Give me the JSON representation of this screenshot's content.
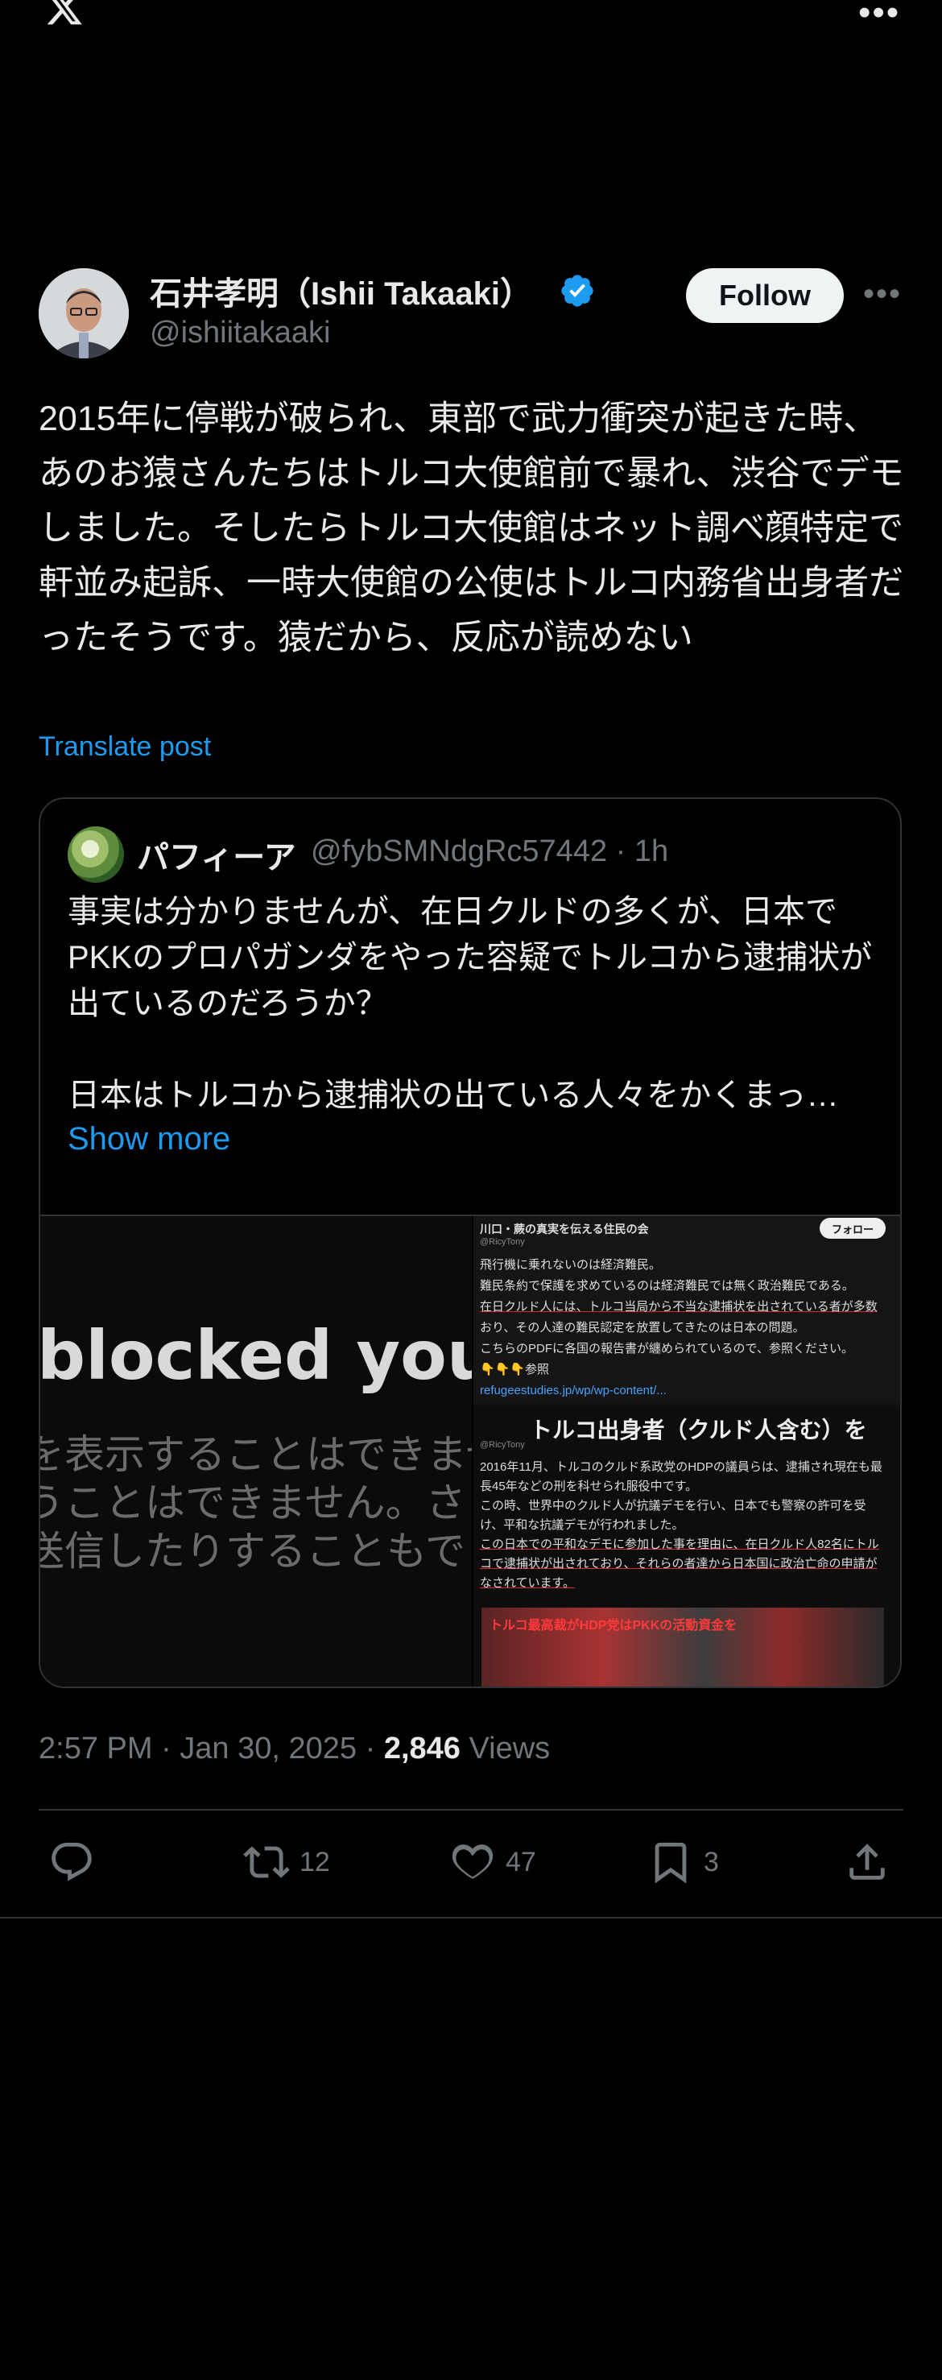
{
  "top_bar": {
    "logo_icon": "x-logo-icon",
    "more_icon": "more-dots-icon"
  },
  "author": {
    "name": "石井孝明（Ishii Takaaki）",
    "handle": "@ishiitakaaki",
    "verified_icon": "verified-badge-icon",
    "follow_label": "Follow"
  },
  "post": {
    "text": "2015年に停戦が破られ、東部で武力衝突が起きた時、あのお猿さんたちはトルコ大使館前で暴れ、渋谷でデモしました。そしたらトルコ大使館はネット調べ顔特定で軒並み起訴、一時大使館の公使はトルコ内務省出身者だったそうです。猿だから、反応が読めない",
    "translate_label": "Translate post"
  },
  "quote": {
    "name": "パフィーア",
    "handle_time": "@fybSMNdgRc57442 · 1h",
    "text": "事実は分かりませんが、在日クルドの多くが、日本でPKKのプロパガンダをやった容疑でトルコから逮捕状が出ているのだろうか？\n\n日本はトルコから逮捕状の出ている人々をかくまっ…",
    "show_more": "Show more",
    "image_left": {
      "title": "blocked you",
      "lines": [
        "を表示することはできませ",
        "うことはできません。さ",
        "送信したりすることもで"
      ]
    },
    "image_right": {
      "account": "川口・蕨の真実を伝える住民の会",
      "account_handle": "@RicyTony",
      "follow": "フォロー",
      "lines": [
        "飛行機に乗れないのは経済難民。",
        "難民条約で保護を求めているのは経済難民では無く政治難民である。",
        "在日クルド人には、トルコ当局から不当な逮捕状を出されている者が多数",
        "おり、その人達の難民認定を放置してきたのは日本の問題。",
        "こちらのPDFに各国の報告書が纏められているので、参照ください。",
        "👇👇👇参照",
        "refugeestudies.jp/wp/wp-content/..."
      ],
      "panel2_title": "トルコ出身者（クルド人含む）を",
      "panel2_handle": "@RicyTony",
      "panel2_lines": [
        "2016年11月、トルコのクルド系政党のHDPの議員らは、逮捕され現在も最",
        "長45年などの刑を科せられ服役中です。",
        "この時、世界中のクルド人が抗議デモを行い、日本でも警察の許可を受",
        "け、平和な抗議デモが行われました。",
        "この日本での平和なデモに参加した事を理由に、在日クルド人82名にトル",
        "コで逮捕状が出されており、それらの者達から日本国に政治亡命の申請が",
        "なされています。"
      ],
      "photo_caption": "トルコ最高裁がHDP党はPKKの活動資金を"
    }
  },
  "meta": {
    "time_date": "2:57 PM · Jan 30, 2025 · ",
    "views_count": "2,846",
    "views_label": " Views"
  },
  "actions": {
    "reply_icon": "reply-icon",
    "retweet_icon": "retweet-icon",
    "retweets": "12",
    "like_icon": "heart-icon",
    "likes": "47",
    "bookmark_icon": "bookmark-icon",
    "bookmarks": "3",
    "share_icon": "share-icon"
  },
  "colors": {
    "accent": "#1d9bf0",
    "muted": "#71767b",
    "text": "#e7e9ea",
    "border": "#2f3336"
  }
}
